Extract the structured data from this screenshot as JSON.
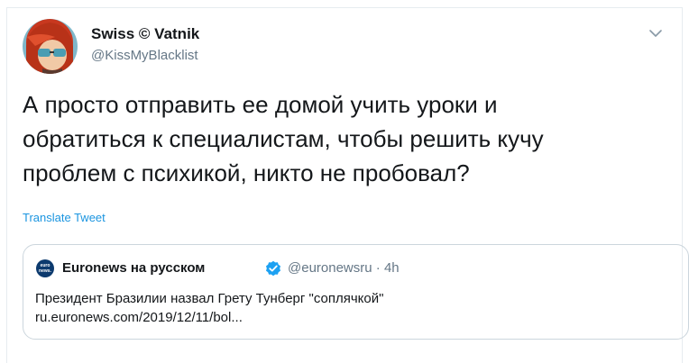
{
  "tweet": {
    "display_name": "Swiss © Vatnik",
    "handle": "@KissMyBlacklist",
    "text_lines": [
      "А просто отправить ее домой учить уроки и",
      "обратиться к специалистам, чтобы решить кучу",
      "проблем с психикой, никто не пробовал?"
    ],
    "translate_label": "Translate Tweet"
  },
  "quoted": {
    "logo_text_top": "euro",
    "logo_text_bottom": "news.",
    "display_name": "Euronews на русском",
    "handle": "@euronewsru",
    "separator": "·",
    "time": "4h",
    "text_lines": [
      "Президент Бразилии назвал Грету Тунберг \"соплячкой\"",
      "ru.euronews.com/2019/12/11/bol..."
    ]
  },
  "icons": {
    "caret": "chevron-down-icon",
    "verified": "verified-badge-icon"
  },
  "colors": {
    "link": "#1b95e0",
    "secondary_text": "#657786",
    "border": "#ccd6dd",
    "verified": "#1da1f2"
  }
}
